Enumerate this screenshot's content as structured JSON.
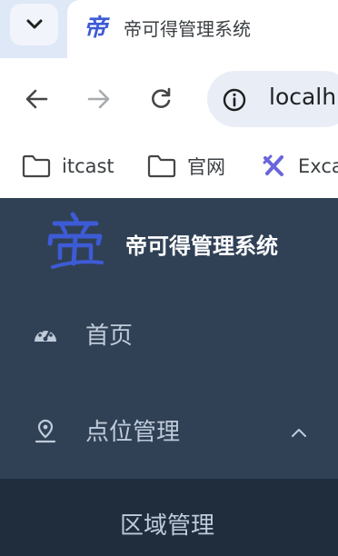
{
  "browser": {
    "tab": {
      "title": "帝可得管理系统",
      "favicon": "帝"
    },
    "address_bar": {
      "url": "localh"
    },
    "bookmarks": [
      {
        "label": "itcast",
        "icon": "folder-icon"
      },
      {
        "label": "官网",
        "icon": "folder-icon"
      },
      {
        "label": "Exca",
        "icon": "excalidraw-icon"
      }
    ]
  },
  "app": {
    "title": "帝可得管理系统",
    "logo_text": "帝",
    "colors": {
      "sidebar_bg": "#304156",
      "submenu_bg": "#1f2d3d",
      "menu_text": "#bfcbd9",
      "logo_accent": "#3d5bd6"
    }
  },
  "sidebar": {
    "items": [
      {
        "label": "首页",
        "icon": "dashboard-icon"
      },
      {
        "label": "点位管理",
        "icon": "location-icon",
        "expanded": true
      }
    ],
    "submenu": [
      {
        "label": "区域管理"
      }
    ]
  }
}
